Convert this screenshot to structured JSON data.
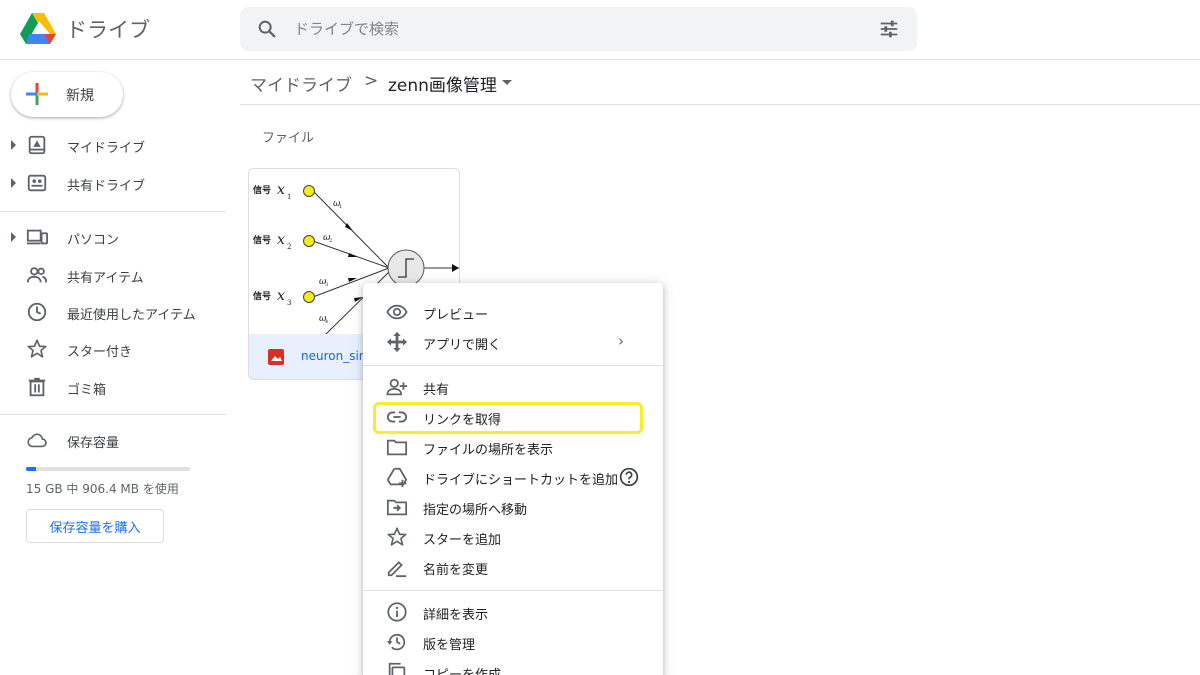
{
  "header": {
    "app_title": "ドライブ",
    "search_placeholder": "ドライブで検索"
  },
  "sidebar": {
    "new_button": "新規",
    "items": [
      {
        "label": "マイドライブ",
        "icon": "my-drive-icon"
      },
      {
        "label": "共有ドライブ",
        "icon": "shared-drives-icon"
      },
      {
        "label": "パソコン",
        "icon": "computers-icon"
      },
      {
        "label": "共有アイテム",
        "icon": "shared-with-me-icon"
      },
      {
        "label": "最近使用したアイテム",
        "icon": "recent-icon"
      },
      {
        "label": "スター付き",
        "icon": "star-icon"
      },
      {
        "label": "ゴミ箱",
        "icon": "trash-icon"
      },
      {
        "label": "保存容量",
        "icon": "cloud-icon"
      }
    ],
    "storage": {
      "used_fraction": 0.06,
      "text": "15 GB 中 906.4 MB を使用",
      "buy_button": "保存容量を購入"
    }
  },
  "breadcrumb": {
    "root": "マイドライブ",
    "separator": ">",
    "current": "zenn画像管理"
  },
  "main": {
    "section_label": "ファイル",
    "file": {
      "name": "neuron_sing",
      "thumbnail": {
        "signal_labels": [
          "信号",
          "信号",
          "信号"
        ],
        "input_vars": [
          "x",
          "x",
          "x"
        ],
        "input_subs": [
          "1",
          "2",
          "3"
        ],
        "weight_vars": [
          "ω",
          "ω",
          "ω",
          "ω"
        ],
        "weight_subs": [
          "1",
          "2",
          "3",
          "4"
        ]
      }
    }
  },
  "context_menu": {
    "items": [
      {
        "label": "プレビュー",
        "icon": "eye-icon"
      },
      {
        "label": "アプリで開く",
        "icon": "open-with-icon",
        "has_submenu": true,
        "submenu_chevron": "›"
      },
      {
        "label": "共有",
        "icon": "person-add-icon"
      },
      {
        "label": "リンクを取得",
        "icon": "link-icon",
        "highlighted": true
      },
      {
        "label": "ファイルの場所を表示",
        "icon": "folder-icon"
      },
      {
        "label": "ドライブにショートカットを追加",
        "icon": "add-shortcut-icon",
        "help": true
      },
      {
        "label": "指定の場所へ移動",
        "icon": "move-to-folder-icon"
      },
      {
        "label": "スターを追加",
        "icon": "star-outline-icon"
      },
      {
        "label": "名前を変更",
        "icon": "edit-icon"
      },
      {
        "label": "詳細を表示",
        "icon": "info-icon"
      },
      {
        "label": "版を管理",
        "icon": "history-icon"
      },
      {
        "label": "コピーを作成",
        "icon": "copy-icon"
      }
    ],
    "highlight_color": "#f2ef2b"
  },
  "colors": {
    "accent": "#1a73e8",
    "selected_bg": "#e8f0fe",
    "text": "#3c4043"
  }
}
